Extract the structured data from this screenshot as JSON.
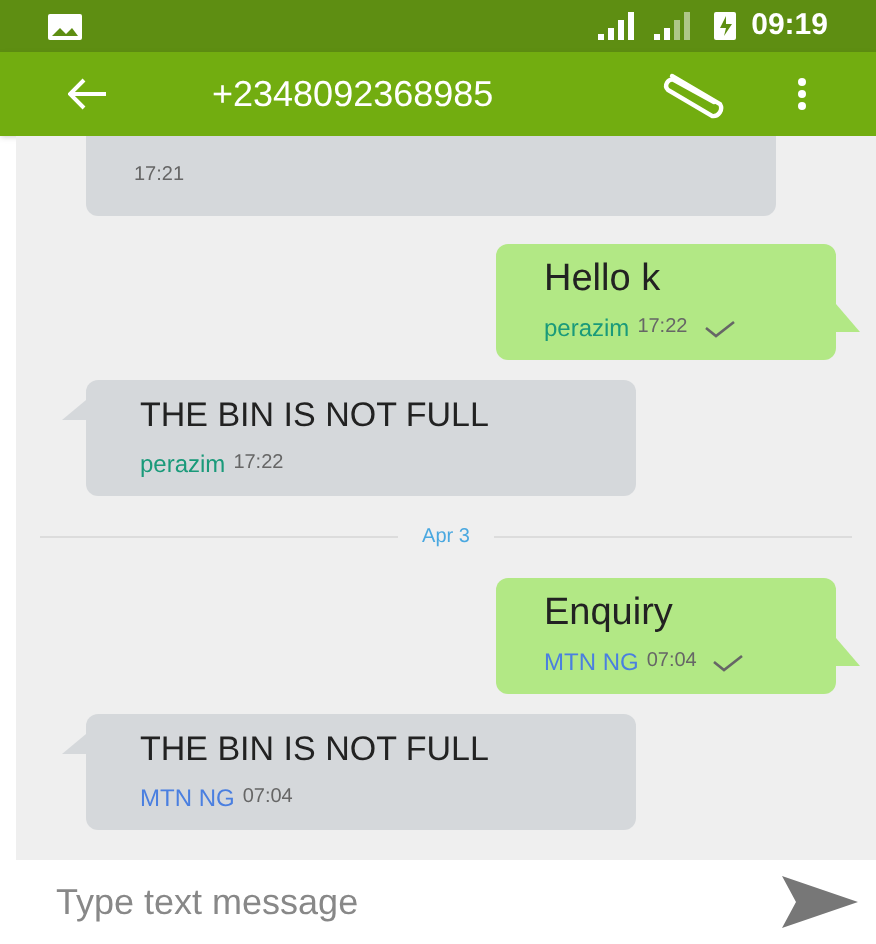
{
  "status_bar": {
    "time": "09:19"
  },
  "app_bar": {
    "title": "+2348092368985"
  },
  "messages": [
    {
      "kind": "incoming",
      "time": "17:21"
    },
    {
      "kind": "outgoing",
      "text": "Hello k",
      "sender": "perazim",
      "color": "#1a9a7a",
      "time": "17:22",
      "delivered": true
    },
    {
      "kind": "incoming",
      "text": "THE BIN IS NOT FULL",
      "sender": "perazim",
      "color": "#1a9a7a",
      "time": "17:22"
    },
    {
      "kind": "date",
      "text": "Apr 3"
    },
    {
      "kind": "outgoing",
      "text": "Enquiry",
      "sender": "MTN NG",
      "color": "#4a7fe0",
      "time": "07:04",
      "delivered": true
    },
    {
      "kind": "incoming",
      "text": "THE BIN IS NOT FULL",
      "sender": "MTN NG",
      "color": "#4a7fe0",
      "time": "07:04"
    }
  ],
  "composer": {
    "placeholder": "Type text message"
  }
}
